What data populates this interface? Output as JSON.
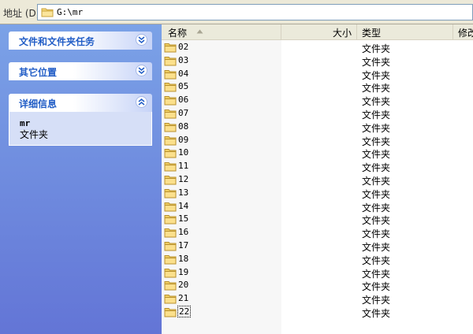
{
  "address_bar": {
    "label": "地址 (D)",
    "path": "G:\\mr"
  },
  "tasks_panel": {
    "sections": [
      {
        "title": "文件和文件夹任务",
        "state": "collapsed"
      },
      {
        "title": "其它位置",
        "state": "collapsed"
      },
      {
        "title": "详细信息",
        "state": "expanded",
        "detail_name": "mr",
        "detail_type": "文件夹"
      }
    ]
  },
  "file_list": {
    "columns": {
      "name": "名称",
      "size": "大小",
      "type": "类型",
      "modified": "修改"
    },
    "sort": "name-ascending",
    "rows": [
      {
        "name": "02",
        "type": "文件夹"
      },
      {
        "name": "03",
        "type": "文件夹"
      },
      {
        "name": "04",
        "type": "文件夹"
      },
      {
        "name": "05",
        "type": "文件夹"
      },
      {
        "name": "06",
        "type": "文件夹"
      },
      {
        "name": "07",
        "type": "文件夹"
      },
      {
        "name": "08",
        "type": "文件夹"
      },
      {
        "name": "09",
        "type": "文件夹"
      },
      {
        "name": "10",
        "type": "文件夹"
      },
      {
        "name": "11",
        "type": "文件夹"
      },
      {
        "name": "12",
        "type": "文件夹"
      },
      {
        "name": "13",
        "type": "文件夹"
      },
      {
        "name": "14",
        "type": "文件夹"
      },
      {
        "name": "15",
        "type": "文件夹"
      },
      {
        "name": "16",
        "type": "文件夹"
      },
      {
        "name": "17",
        "type": "文件夹"
      },
      {
        "name": "18",
        "type": "文件夹"
      },
      {
        "name": "19",
        "type": "文件夹"
      },
      {
        "name": "20",
        "type": "文件夹"
      },
      {
        "name": "21",
        "type": "文件夹"
      },
      {
        "name": "22",
        "type": "文件夹",
        "focused": true
      }
    ]
  },
  "icons": {
    "folder": "folder-icon",
    "collapse": "chevron-double-down-icon",
    "expand": "chevron-double-up-icon",
    "sort": "sort-ascending-icon"
  }
}
